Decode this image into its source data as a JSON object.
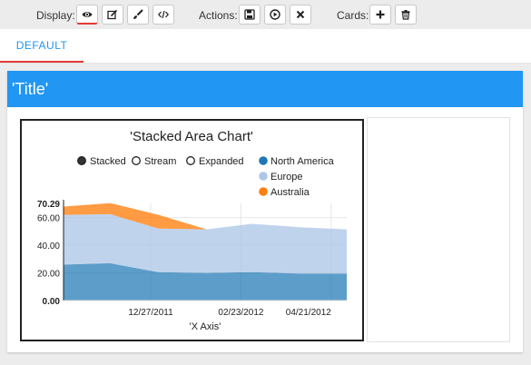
{
  "toolbar": {
    "display_label": "Display:",
    "actions_label": "Actions:",
    "cards_label": "Cards:",
    "buttons": {
      "view": "eye-icon",
      "edit": "edit-icon",
      "style": "brush-icon",
      "code": "code-icon",
      "save": "floppy-icon",
      "play": "play-icon",
      "close": "close-icon",
      "add": "plus-icon",
      "delete": "trash-icon"
    }
  },
  "tabs": [
    {
      "label": "DEFAULT",
      "active": true
    }
  ],
  "card": {
    "title": "'Title'"
  },
  "colors": {
    "accent": "#2196f3",
    "active_indicator": "#e53935",
    "north_america": "#1f77b4",
    "europe": "#aec7e8",
    "australia": "#ff7f0e"
  },
  "chart_data": {
    "type": "area",
    "stacked": true,
    "title": "'Stacked Area Chart'",
    "xlabel": "'X Axis'",
    "ylabel": "",
    "x": [
      "2011-11-01",
      "2011-12-01",
      "2012-01-01",
      "2012-02-01",
      "2012-03-01",
      "2012-04-01",
      "2012-05-01"
    ],
    "x_ticks": [
      "12/27/2011",
      "02/23/2012",
      "04/21/2012"
    ],
    "y_ticks": [
      "0.00",
      "20.00",
      "40.00",
      "60.00",
      "70.29"
    ],
    "ylim": [
      0,
      70.29
    ],
    "controls": [
      "Stacked",
      "Stream",
      "Expanded"
    ],
    "selected_control": "Stacked",
    "legend_position": "top-right",
    "series": [
      {
        "name": "North America",
        "color": "#1f77b4",
        "values": [
          26,
          27,
          20.5,
          20,
          20.5,
          19.5,
          19.5
        ]
      },
      {
        "name": "Europe",
        "color": "#aec7e8",
        "values": [
          36,
          35.5,
          31.5,
          31.5,
          35,
          33.5,
          32
        ]
      },
      {
        "name": "Australia",
        "color": "#ff7f0e",
        "values": [
          6,
          8,
          10,
          0,
          0,
          0,
          0
        ]
      }
    ]
  }
}
